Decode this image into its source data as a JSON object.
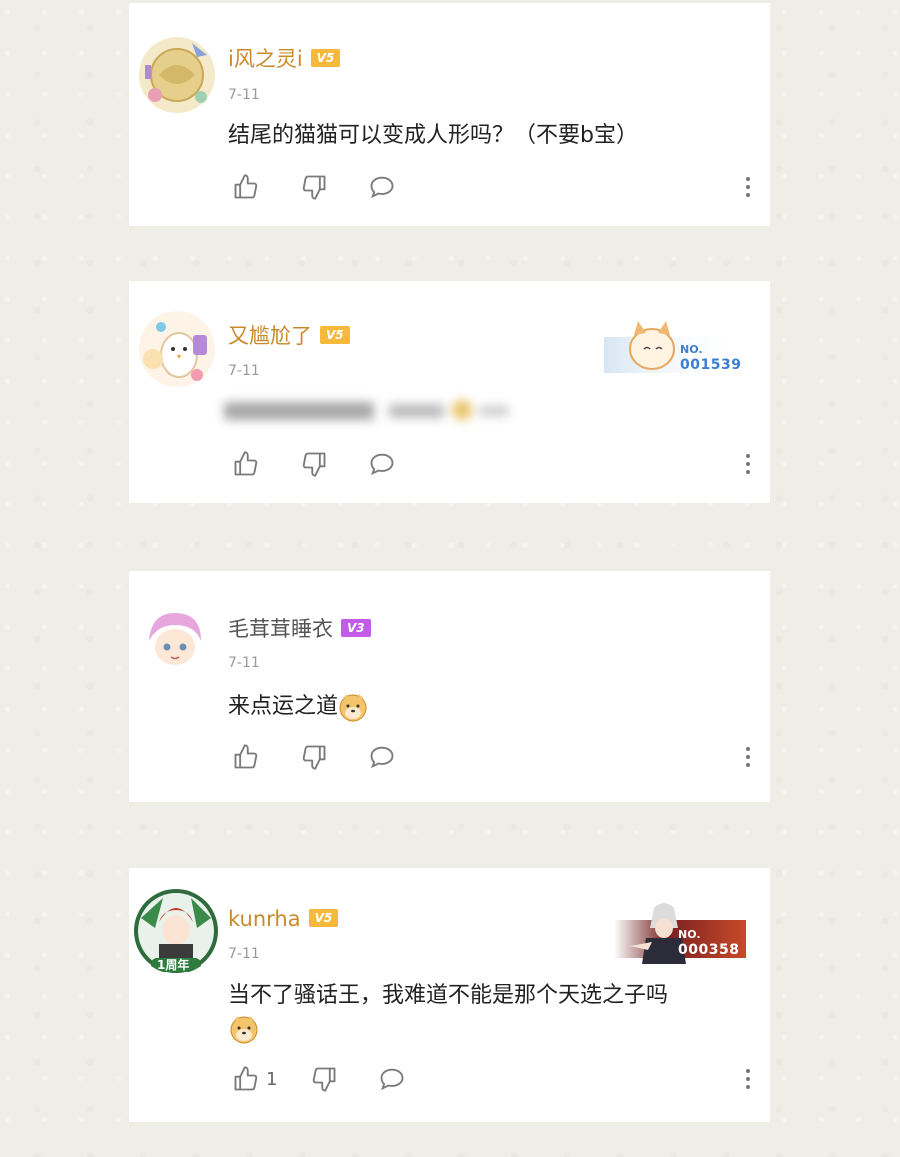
{
  "comments": [
    {
      "username": "i风之灵i",
      "level": "V5",
      "date": "7-11",
      "text": "结尾的猫猫可以变成人形吗？（不要b宝）",
      "likes": ""
    },
    {
      "username": "又尴尬了",
      "level": "V5",
      "date": "7-11",
      "fan_badge": {
        "label": "NO.",
        "number": "001539"
      },
      "likes": ""
    },
    {
      "username": "毛茸茸睡衣",
      "level": "V3",
      "date": "7-11",
      "text": "来点运之道",
      "likes": ""
    },
    {
      "username": "kunrha",
      "level": "V5",
      "date": "7-11",
      "fan_badge": {
        "label": "NO.",
        "number": "000358"
      },
      "avatar_label": "1周年",
      "text": "当不了骚话王，我难道不能是那个天选之子吗",
      "likes": "1"
    }
  ],
  "colors": {
    "gold_name": "#c98a2a",
    "v5_badge": "#f6b93b",
    "v3_badge": "#c25ce8",
    "icon": "#7a7a7a"
  },
  "icons": [
    "thumbs-up-icon",
    "thumbs-down-icon",
    "comment-icon",
    "more-vertical-icon",
    "doge-emoji-icon"
  ]
}
